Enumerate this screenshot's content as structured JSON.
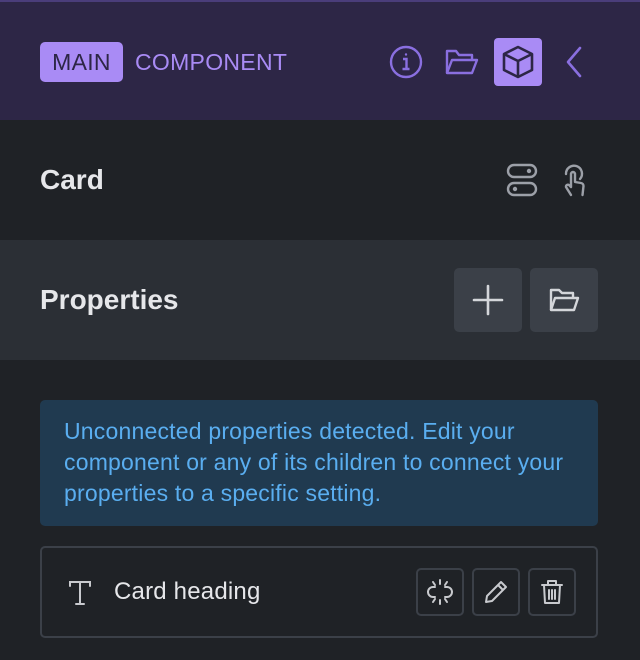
{
  "header": {
    "badge_label": "MAIN",
    "title": "COMPONENT",
    "icons": [
      "info-icon",
      "folder-open-icon",
      "box-icon",
      "chevron-left-icon"
    ]
  },
  "component": {
    "name": "Card",
    "icons": [
      "toggle-icon",
      "touch-icon"
    ]
  },
  "properties": {
    "title": "Properties",
    "icons": [
      "plus-icon",
      "folder-open-icon"
    ]
  },
  "notice": {
    "text": "Unconnected properties detected. Edit your component or any of its children to connect your properties to a specific setting."
  },
  "property_items": [
    {
      "type_icon": "text-type-icon",
      "label": "Card heading",
      "actions": [
        "unlink-icon",
        "pencil-icon",
        "trash-icon"
      ]
    }
  ],
  "colors": {
    "accent": "#a98bf5",
    "header_bg": "#2d2646",
    "notice_bg": "#203a50",
    "notice_text": "#5aaef0"
  }
}
